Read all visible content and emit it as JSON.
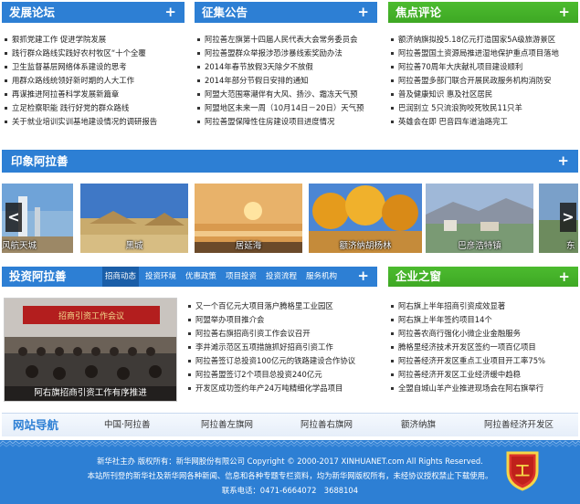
{
  "columns": {
    "forum": {
      "title": "发展论坛",
      "plus": "+",
      "items": [
        "狠抓党建工作 促进学院发展",
        "践行群众路线实践好农村牧区“十个全覆",
        "卫生监督基层网络体系建设的思考",
        "用群众路线统领好新时期的人大工作",
        "再谋推进阿拉善科学发展新篇章",
        "立足检察职能 践行好党的群众路线",
        "关于就业培训实训基地建设情况的调研报告"
      ]
    },
    "notice": {
      "title": "征集公告",
      "plus": "+",
      "items": [
        "阿拉善左旗第十四届人民代表大会常务委员会",
        "阿拉善盟群众举报涉恐涉暴线索奖励办法",
        "2014年春节放假3天除夕不放假",
        "2014年部分节假日安排的通知",
        "阿盟大范围寒潮伴有大风、扬沙、霜冻天气预",
        "阿盟地区未来一周（10月14日－20日）天气预",
        "阿拉善盟保障性住房建设项目进度情况"
      ]
    },
    "focus": {
      "title": "焦点评论",
      "plus": "+",
      "items": [
        "额济纳旗拟投5.18亿元打造国家5A级旅游景区",
        "阿拉善盟国土资源局推进湿地保护重点项目落地",
        "阿拉善70周年大庆献礼项目建设顺利",
        "阿拉善盟多部门联合开展民政服务机构消防安",
        "普及健康知识 惠及社区居民",
        "巴润别立 5只流浪狗咬死牧民11只羊",
        "英雄会在即 巴音四车道油路完工"
      ]
    }
  },
  "impression": {
    "title": "印象阿拉善",
    "plus": "+",
    "gallery": [
      {
        "caption": "风航天城"
      },
      {
        "caption": "黑城"
      },
      {
        "caption": "居延海"
      },
      {
        "caption": "额济纳胡杨林"
      },
      {
        "caption": "巴彦浩特镇"
      },
      {
        "caption": "东"
      }
    ],
    "prev": "<",
    "next": ">"
  },
  "investment": {
    "title": "投资阿拉善",
    "tabs": [
      "招商动态",
      "投资环境",
      "优惠政策",
      "项目投资",
      "投资流程",
      "服务机构"
    ],
    "plus": "+",
    "photo_caption": "阿右旗招商引资工作有序推进",
    "banner_text": "招商引资工作会议",
    "items": [
      "又一个百亿元大项目落户腾格里工业园区",
      "阿盟举办项目推介会",
      "阿拉善右旗招商引资工作会议召开",
      "李井滩示范区五项措施抓好招商引资工作",
      "阿拉善签订总投资100亿元的铁路建设合作协议",
      "阿拉善盟签订2个项目总投资240亿元",
      "开发区成功签约年产24万吨精细化学品项目"
    ]
  },
  "enterprise": {
    "title": "企业之窗",
    "plus": "+",
    "items": [
      "阿右旗上半年招商引资成效显著",
      "阿右旗上半年签约项目14个",
      "阿拉善农商行强化小微企业金融服务",
      "腾格里经济技术开发区签约一项百亿项目",
      "阿拉善经济开发区重点工业项目开工率75%",
      "阿拉善经济开发区工业经济缓中趋稳",
      "全盟自城山羊产业推进现场会在阿右旗举行"
    ]
  },
  "nav": {
    "title": "网站导航",
    "links": [
      "中国·阿拉善",
      "阿拉善左旗网",
      "阿拉善右旗网",
      "额济纳旗",
      "阿拉善经济开发区"
    ]
  },
  "footer": {
    "line1": "新华社主办 版权所有：新华网股份有限公司 Copyright © 2000-2017 XINHUANET.com All Rights Reserved.",
    "line2": "本站所刊登的新华社及新华网各种新闻、信息和各种专题专栏资料，均为新华网版权所有，未经协议授权禁止下载使用。",
    "line3": "联系电话：0471-6664072　3688104",
    "seal_text": "工"
  },
  "colors": {
    "blue": "#2d7fd4",
    "green": "#46b12a",
    "footer_blue": "#2d7fd4"
  }
}
